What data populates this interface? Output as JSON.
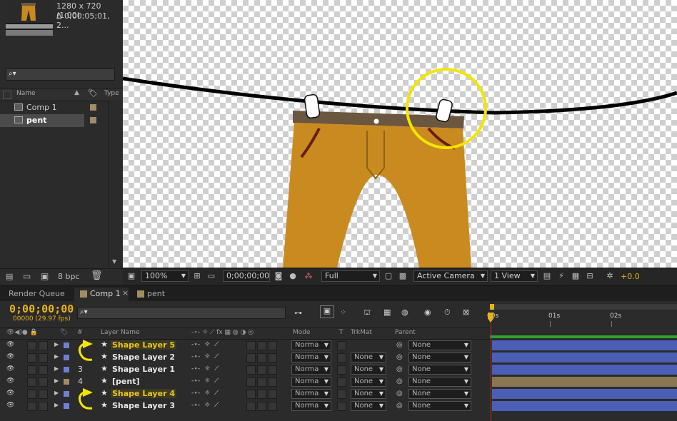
{
  "project": {
    "info_resolution": "1280 x 720 (1.00)",
    "info_duration": "Δ 0;00;05;01, 2...",
    "header_name": "Name",
    "header_type": "Type",
    "items": [
      {
        "label": "Comp 1"
      },
      {
        "label": "pent"
      }
    ],
    "bpc": "8 bpc"
  },
  "viewer": {
    "zoom": "100%",
    "timecode": "0;00;00;00",
    "resolution": "Full",
    "camera": "Active Camera",
    "view": "1 View",
    "exposure": "+0.0"
  },
  "tabs": {
    "render_queue": "Render Queue",
    "comp": "Comp 1",
    "close": "×",
    "pent": "pent"
  },
  "timeline": {
    "timecode": "0;00;00;00",
    "fps": "00000 (29.97 fps)",
    "columns": {
      "num": "#",
      "layer_name": "Layer Name",
      "mode": "Mode",
      "t": "T",
      "trkmat": "TrkMat",
      "parent": "Parent"
    },
    "ruler": [
      "00s",
      "01s",
      "02s"
    ],
    "layers": [
      {
        "num": "",
        "name": "Shape Layer 5",
        "selected": true,
        "mode": "Norma",
        "trkmat": "",
        "parent": "None",
        "color": "#6e7fd6"
      },
      {
        "num": "",
        "name": "Shape Layer 2",
        "selected": false,
        "mode": "Norma",
        "trkmat": "None",
        "parent": "None",
        "color": "#6e7fd6"
      },
      {
        "num": "3",
        "name": "Shape Layer 1",
        "selected": false,
        "mode": "Norma",
        "trkmat": "None",
        "parent": "None",
        "color": "#6e7fd6"
      },
      {
        "num": "4",
        "name": "[pent]",
        "selected": false,
        "mode": "Norma",
        "trkmat": "None",
        "parent": "None",
        "color": "#a38b63"
      },
      {
        "num": "",
        "name": "Shape Layer 4",
        "selected": true,
        "mode": "Norma",
        "trkmat": "None",
        "parent": "None",
        "color": "#6e7fd6"
      },
      {
        "num": "",
        "name": "Shape Layer 3",
        "selected": false,
        "mode": "Norma",
        "trkmat": "None",
        "parent": "None",
        "color": "#6e7fd6"
      }
    ]
  },
  "colors": {
    "accent": "#e6b219",
    "layer_blue": "#4a5fb5",
    "layer_tan": "#8a7653",
    "annotation": "#f2e600",
    "pants": "#c88a1f"
  }
}
